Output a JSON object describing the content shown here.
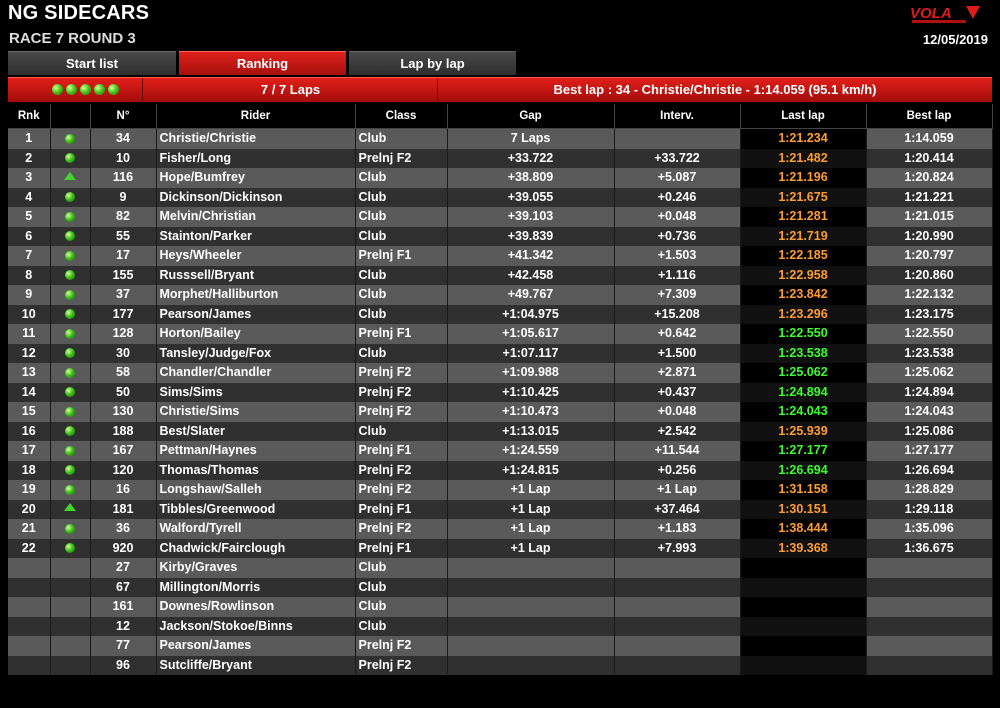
{
  "header": {
    "title": "NG SIDECARS",
    "subtitle": "RACE 7 ROUND 3",
    "date": "12/05/2019",
    "logo_text": "VOLA"
  },
  "tabs": [
    {
      "label": "Start list",
      "active": false
    },
    {
      "label": "Ranking",
      "active": true
    },
    {
      "label": "Lap by lap",
      "active": false
    }
  ],
  "infobar": {
    "lights": 5,
    "laps": "7 / 7 Laps",
    "best_lap": "Best lap : 34 - Christie/Christie - 1:14.059 (95.1 km/h)"
  },
  "columns": [
    "Rnk",
    "",
    "N°",
    "Rider",
    "Class",
    "Gap",
    "Interv.",
    "Last lap",
    "Best lap"
  ],
  "colors": {
    "orange": "#ff9d2e",
    "green": "#39ff2a",
    "accent": "#d8191a"
  },
  "rows": [
    {
      "rnk": "1",
      "status": "dot",
      "num": "34",
      "rider": "Christie/Christie",
      "cls": "Club",
      "gap": "7 Laps",
      "interv": "",
      "last": "1:21.234",
      "lc": "orange",
      "best": "1:14.059"
    },
    {
      "rnk": "2",
      "status": "dot",
      "num": "10",
      "rider": "Fisher/Long",
      "cls": "Prelnj F2",
      "gap": "+33.722",
      "interv": "+33.722",
      "last": "1:21.482",
      "lc": "orange",
      "best": "1:20.414"
    },
    {
      "rnk": "3",
      "status": "up",
      "num": "116",
      "rider": "Hope/Bumfrey",
      "cls": "Club",
      "gap": "+38.809",
      "interv": "+5.087",
      "last": "1:21.196",
      "lc": "orange",
      "best": "1:20.824"
    },
    {
      "rnk": "4",
      "status": "dot",
      "num": "9",
      "rider": "Dickinson/Dickinson",
      "cls": "Club",
      "gap": "+39.055",
      "interv": "+0.246",
      "last": "1:21.675",
      "lc": "orange",
      "best": "1:21.221"
    },
    {
      "rnk": "5",
      "status": "dot",
      "num": "82",
      "rider": "Melvin/Christian",
      "cls": "Club",
      "gap": "+39.103",
      "interv": "+0.048",
      "last": "1:21.281",
      "lc": "orange",
      "best": "1:21.015"
    },
    {
      "rnk": "6",
      "status": "dot",
      "num": "55",
      "rider": "Stainton/Parker",
      "cls": "Club",
      "gap": "+39.839",
      "interv": "+0.736",
      "last": "1:21.719",
      "lc": "orange",
      "best": "1:20.990"
    },
    {
      "rnk": "7",
      "status": "dot",
      "num": "17",
      "rider": "Heys/Wheeler",
      "cls": "Prelnj F1",
      "gap": "+41.342",
      "interv": "+1.503",
      "last": "1:22.185",
      "lc": "orange",
      "best": "1:20.797"
    },
    {
      "rnk": "8",
      "status": "dot",
      "num": "155",
      "rider": "Russsell/Bryant",
      "cls": "Club",
      "gap": "+42.458",
      "interv": "+1.116",
      "last": "1:22.958",
      "lc": "orange",
      "best": "1:20.860"
    },
    {
      "rnk": "9",
      "status": "dot",
      "num": "37",
      "rider": "Morphet/Halliburton",
      "cls": "Club",
      "gap": "+49.767",
      "interv": "+7.309",
      "last": "1:23.842",
      "lc": "orange",
      "best": "1:22.132"
    },
    {
      "rnk": "10",
      "status": "dot",
      "num": "177",
      "rider": "Pearson/James",
      "cls": "Club",
      "gap": "+1:04.975",
      "interv": "+15.208",
      "last": "1:23.296",
      "lc": "orange",
      "best": "1:23.175"
    },
    {
      "rnk": "11",
      "status": "dot",
      "num": "128",
      "rider": "Horton/Bailey",
      "cls": "Prelnj F1",
      "gap": "+1:05.617",
      "interv": "+0.642",
      "last": "1:22.550",
      "lc": "green",
      "best": "1:22.550"
    },
    {
      "rnk": "12",
      "status": "dot",
      "num": "30",
      "rider": "Tansley/Judge/Fox",
      "cls": "Club",
      "gap": "+1:07.117",
      "interv": "+1.500",
      "last": "1:23.538",
      "lc": "green",
      "best": "1:23.538"
    },
    {
      "rnk": "13",
      "status": "dot",
      "num": "58",
      "rider": "Chandler/Chandler",
      "cls": "Prelnj F2",
      "gap": "+1:09.988",
      "interv": "+2.871",
      "last": "1:25.062",
      "lc": "green",
      "best": "1:25.062"
    },
    {
      "rnk": "14",
      "status": "dot",
      "num": "50",
      "rider": "Sims/Sims",
      "cls": "Prelnj F2",
      "gap": "+1:10.425",
      "interv": "+0.437",
      "last": "1:24.894",
      "lc": "green",
      "best": "1:24.894"
    },
    {
      "rnk": "15",
      "status": "dot",
      "num": "130",
      "rider": "Christie/Sims",
      "cls": "Prelnj F2",
      "gap": "+1:10.473",
      "interv": "+0.048",
      "last": "1:24.043",
      "lc": "green",
      "best": "1:24.043"
    },
    {
      "rnk": "16",
      "status": "dot",
      "num": "188",
      "rider": "Best/Slater",
      "cls": "Club",
      "gap": "+1:13.015",
      "interv": "+2.542",
      "last": "1:25.939",
      "lc": "orange",
      "best": "1:25.086"
    },
    {
      "rnk": "17",
      "status": "dot",
      "num": "167",
      "rider": "Pettman/Haynes",
      "cls": "Prelnj F1",
      "gap": "+1:24.559",
      "interv": "+11.544",
      "last": "1:27.177",
      "lc": "green",
      "best": "1:27.177"
    },
    {
      "rnk": "18",
      "status": "dot",
      "num": "120",
      "rider": "Thomas/Thomas",
      "cls": "Prelnj F2",
      "gap": "+1:24.815",
      "interv": "+0.256",
      "last": "1:26.694",
      "lc": "green",
      "best": "1:26.694"
    },
    {
      "rnk": "19",
      "status": "dot",
      "num": "16",
      "rider": "Longshaw/Salleh",
      "cls": "Prelnj F2",
      "gap": "+1 Lap",
      "interv": "+1 Lap",
      "last": "1:31.158",
      "lc": "orange",
      "best": "1:28.829"
    },
    {
      "rnk": "20",
      "status": "up",
      "num": "181",
      "rider": "Tibbles/Greenwood",
      "cls": "Prelnj F1",
      "gap": "+1 Lap",
      "interv": "+37.464",
      "last": "1:30.151",
      "lc": "orange",
      "best": "1:29.118"
    },
    {
      "rnk": "21",
      "status": "dot",
      "num": "36",
      "rider": "Walford/Tyrell",
      "cls": "Prelnj F2",
      "gap": "+1 Lap",
      "interv": "+1.183",
      "last": "1:38.444",
      "lc": "orange",
      "best": "1:35.096"
    },
    {
      "rnk": "22",
      "status": "dot",
      "num": "920",
      "rider": "Chadwick/Fairclough",
      "cls": "Prelnj F1",
      "gap": "+1 Lap",
      "interv": "+7.993",
      "last": "1:39.368",
      "lc": "orange",
      "best": "1:36.675"
    },
    {
      "rnk": "",
      "status": "",
      "num": "27",
      "rider": "Kirby/Graves",
      "cls": "Club",
      "gap": "",
      "interv": "",
      "last": "",
      "lc": "",
      "best": ""
    },
    {
      "rnk": "",
      "status": "",
      "num": "67",
      "rider": "Millington/Morris",
      "cls": "Club",
      "gap": "",
      "interv": "",
      "last": "",
      "lc": "",
      "best": ""
    },
    {
      "rnk": "",
      "status": "",
      "num": "161",
      "rider": "Downes/Rowlinson",
      "cls": "Club",
      "gap": "",
      "interv": "",
      "last": "",
      "lc": "",
      "best": ""
    },
    {
      "rnk": "",
      "status": "",
      "num": "12",
      "rider": "Jackson/Stokoe/Binns",
      "cls": "Club",
      "gap": "",
      "interv": "",
      "last": "",
      "lc": "",
      "best": ""
    },
    {
      "rnk": "",
      "status": "",
      "num": "77",
      "rider": "Pearson/James",
      "cls": "Prelnj F2",
      "gap": "",
      "interv": "",
      "last": "",
      "lc": "",
      "best": ""
    },
    {
      "rnk": "",
      "status": "",
      "num": "96",
      "rider": "Sutcliffe/Bryant",
      "cls": "Prelnj F2",
      "gap": "",
      "interv": "",
      "last": "",
      "lc": "",
      "best": ""
    }
  ]
}
